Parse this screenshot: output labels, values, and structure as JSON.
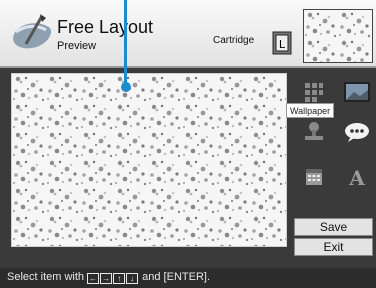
{
  "header": {
    "title": "Free Layout",
    "subtitle": "Preview",
    "cartridge_label": "Cartridge",
    "cartridge_icon_letter": "L"
  },
  "tools": {
    "tooltip": "Wallpaper",
    "text_icon_glyph": "A"
  },
  "buttons": {
    "save": "Save",
    "exit": "Exit"
  },
  "footer": {
    "prefix": "Select item with ",
    "keys": [
      "←",
      "→",
      "↑",
      "↓"
    ],
    "suffix": " and [ENTER]."
  },
  "colors": {
    "cursor": "#1a8ccf",
    "accent": "#1a8ccf"
  },
  "icons": [
    "brush-icon",
    "cartridge-icon",
    "stamp-icon",
    "wallpaper-icon",
    "speech-bubble-icon",
    "calendar-icon",
    "text-icon"
  ]
}
